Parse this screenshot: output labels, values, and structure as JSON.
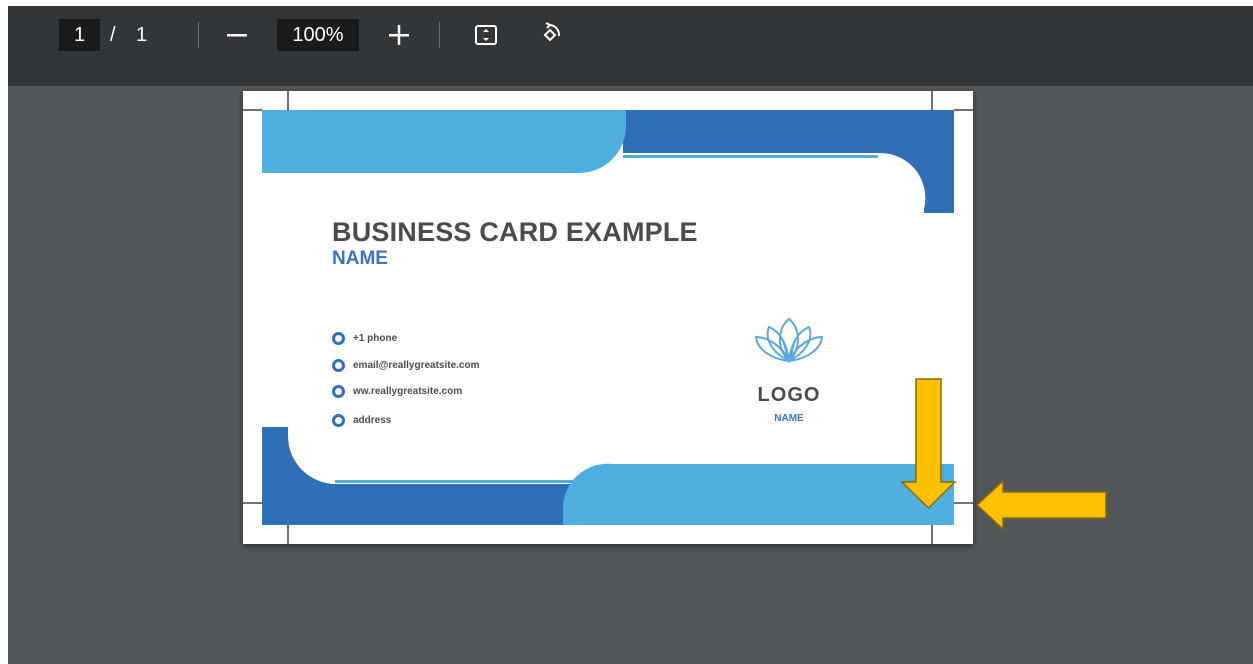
{
  "toolbar": {
    "page_current": "1",
    "page_separator": "/",
    "page_total": "1",
    "zoom_value": "100%",
    "zoom_out_icon": "minus-icon",
    "zoom_in_icon": "plus-icon",
    "fit_icon": "fit-to-page-icon",
    "rotate_icon": "rotate-icon"
  },
  "card": {
    "title": "BUSINESS CARD EXAMPLE",
    "name": "NAME",
    "contacts": [
      {
        "icon": "phone-icon",
        "text": "+1 phone"
      },
      {
        "icon": "email-icon",
        "text": "email@reallygreatsite.com"
      },
      {
        "icon": "globe-icon",
        "text": "ww.reallygreatsite.com"
      },
      {
        "icon": "location-pin-icon",
        "text": "address"
      }
    ],
    "logo_text": "LOGO",
    "logo_name": "NAME",
    "logo_icon": "lotus-icon"
  },
  "colors": {
    "viewer_bg": "#525659",
    "toolbar_bg": "#323639",
    "light_blue": "#4faee0",
    "dark_blue": "#2e6fb8",
    "arrow_fill": "#ffc000",
    "text_dark": "#4b4b4b",
    "text_blue": "#3c73c5"
  },
  "annotations": {
    "arrow_icons": [
      "arrow-down-icon",
      "arrow-left-icon"
    ]
  }
}
